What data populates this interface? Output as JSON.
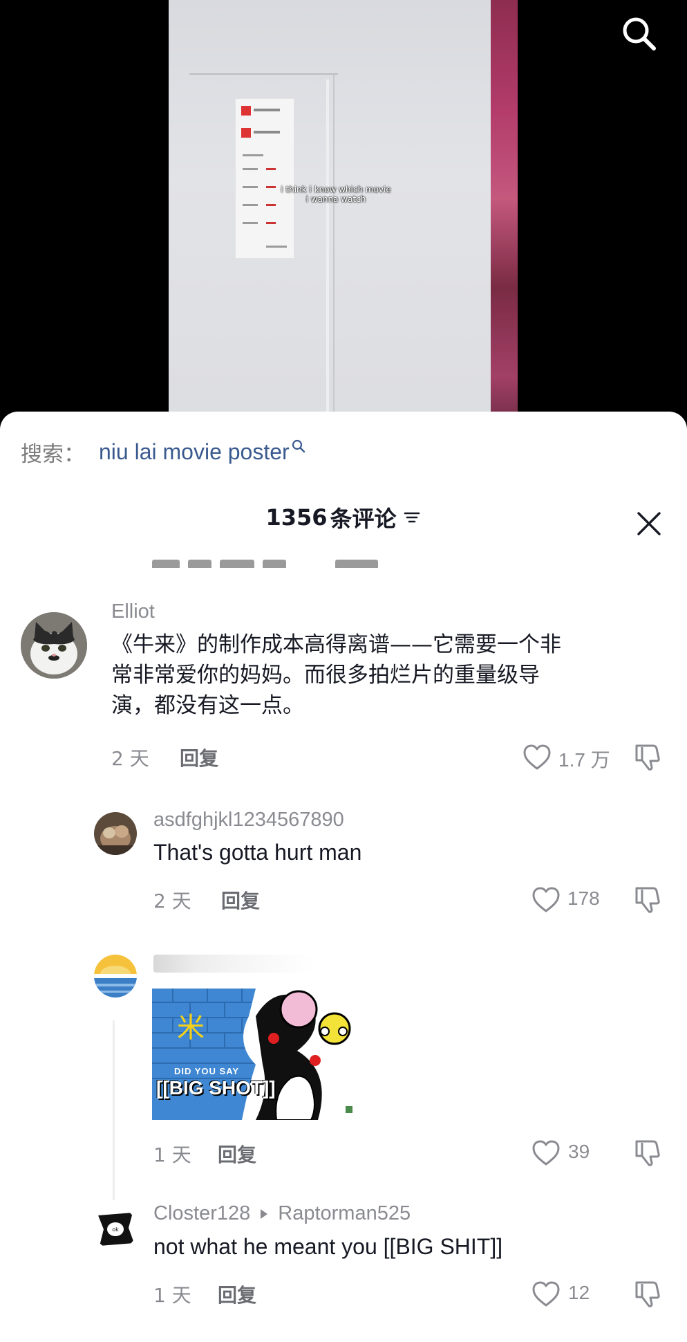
{
  "video": {
    "caption_line1": "i think i know which movie",
    "caption_line2": "i wanna watch"
  },
  "top_search": {
    "icon": "search-icon"
  },
  "search_bar": {
    "prefix": "搜索：",
    "term": "niu lai movie poster",
    "icon": "search-icon"
  },
  "comments_header": {
    "count": "1356",
    "label": "条评论",
    "filter_icon": "filter-icon",
    "close_icon": "close-icon"
  },
  "comments": [
    {
      "username": "Elliot",
      "text_line1": "《牛来》的制作成本高得离谱——它需要一个非",
      "text_line2": "常非常爱你的妈妈。而很多拍烂片的重量级导",
      "text_line3": "演，都没有这一点。",
      "time": "2 天",
      "reply": "回复",
      "likes": "1.7 万"
    },
    {
      "username": "asdfghjkl1234567890",
      "text": "That's gotta hurt man",
      "time": "2 天",
      "reply": "回复",
      "likes": "178"
    },
    {
      "username": "",
      "image_text_small": "DID YOU SAY",
      "image_text_big": "[[BIG SHOT]]",
      "time": "1 天",
      "reply": "回复",
      "likes": "39"
    },
    {
      "username": "Closter128",
      "reply_to": "Raptorman525",
      "text": "not what he meant you [[BIG SHIT]]",
      "time": "1 天",
      "reply": "回复",
      "likes": "12"
    }
  ],
  "colors": {
    "link_blue": "#3a5a8f",
    "text_primary": "#161823",
    "text_secondary": "#8a8b91"
  }
}
